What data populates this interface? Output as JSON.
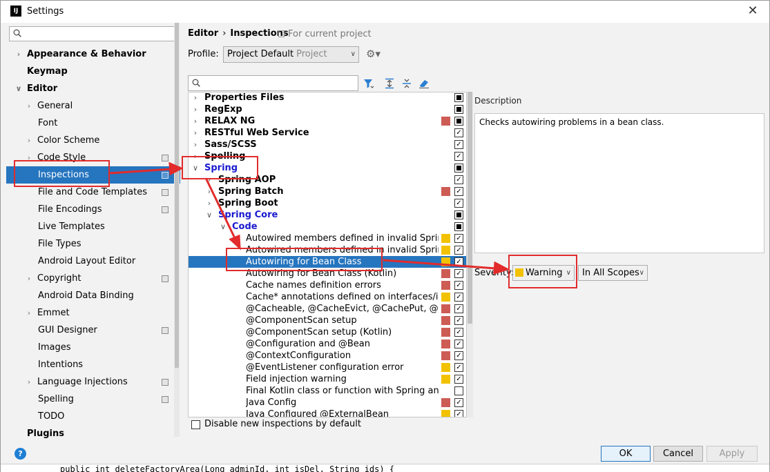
{
  "window": {
    "title": "Settings"
  },
  "sidebar": {
    "search_placeholder": "",
    "items": [
      {
        "label": "Appearance & Behavior",
        "level": 0,
        "expandable": true,
        "expanded": false,
        "bold": true,
        "copy_icon": false
      },
      {
        "label": "Keymap",
        "level": 0,
        "expandable": false,
        "bold": true,
        "copy_icon": false
      },
      {
        "label": "Editor",
        "level": 0,
        "expandable": true,
        "expanded": true,
        "bold": true,
        "copy_icon": false
      },
      {
        "label": "General",
        "level": 1,
        "expandable": true,
        "expanded": false,
        "bold": false,
        "copy_icon": false
      },
      {
        "label": "Font",
        "level": 1,
        "expandable": false,
        "bold": false,
        "copy_icon": false
      },
      {
        "label": "Color Scheme",
        "level": 1,
        "expandable": true,
        "expanded": false,
        "bold": false,
        "copy_icon": false
      },
      {
        "label": "Code Style",
        "level": 1,
        "expandable": true,
        "expanded": false,
        "bold": false,
        "copy_icon": true
      },
      {
        "label": "Inspections",
        "level": 1,
        "expandable": false,
        "bold": false,
        "copy_icon": true,
        "selected": true
      },
      {
        "label": "File and Code Templates",
        "level": 1,
        "expandable": false,
        "bold": false,
        "copy_icon": true
      },
      {
        "label": "File Encodings",
        "level": 1,
        "expandable": false,
        "bold": false,
        "copy_icon": true
      },
      {
        "label": "Live Templates",
        "level": 1,
        "expandable": false,
        "bold": false,
        "copy_icon": false
      },
      {
        "label": "File Types",
        "level": 1,
        "expandable": false,
        "bold": false,
        "copy_icon": false
      },
      {
        "label": "Android Layout Editor",
        "level": 1,
        "expandable": false,
        "bold": false,
        "copy_icon": false
      },
      {
        "label": "Copyright",
        "level": 1,
        "expandable": true,
        "expanded": false,
        "bold": false,
        "copy_icon": true
      },
      {
        "label": "Android Data Binding",
        "level": 1,
        "expandable": false,
        "bold": false,
        "copy_icon": false
      },
      {
        "label": "Emmet",
        "level": 1,
        "expandable": true,
        "expanded": false,
        "bold": false,
        "copy_icon": false
      },
      {
        "label": "GUI Designer",
        "level": 1,
        "expandable": false,
        "bold": false,
        "copy_icon": true
      },
      {
        "label": "Images",
        "level": 1,
        "expandable": false,
        "bold": false,
        "copy_icon": false
      },
      {
        "label": "Intentions",
        "level": 1,
        "expandable": false,
        "bold": false,
        "copy_icon": false
      },
      {
        "label": "Language Injections",
        "level": 1,
        "expandable": true,
        "expanded": false,
        "bold": false,
        "copy_icon": true
      },
      {
        "label": "Spelling",
        "level": 1,
        "expandable": false,
        "bold": false,
        "copy_icon": true
      },
      {
        "label": "TODO",
        "level": 1,
        "expandable": false,
        "bold": false,
        "copy_icon": false
      },
      {
        "label": "Plugins",
        "level": 0,
        "expandable": false,
        "bold": true,
        "copy_icon": false
      }
    ]
  },
  "header": {
    "breadcrumb": [
      "Editor",
      "Inspections"
    ],
    "breadcrumb_sep": "›",
    "note": "For current project"
  },
  "profile": {
    "label": "Profile:",
    "value": "Project Default",
    "sub": "Project"
  },
  "inspections": {
    "search_placeholder": "",
    "rows": [
      {
        "label": "Properties Files",
        "level": 0,
        "chev": "right",
        "style": "bold",
        "sev": "",
        "check": "partial"
      },
      {
        "label": "RegExp",
        "level": 0,
        "chev": "right",
        "style": "bold",
        "sev": "",
        "check": "partial"
      },
      {
        "label": "RELAX NG",
        "level": 0,
        "chev": "right",
        "style": "bold",
        "sev": "red",
        "check": "partial"
      },
      {
        "label": "RESTful Web Service",
        "level": 0,
        "chev": "right",
        "style": "bold",
        "sev": "",
        "check": "checked"
      },
      {
        "label": "Sass/SCSS",
        "level": 0,
        "chev": "right",
        "style": "bold",
        "sev": "",
        "check": "checked"
      },
      {
        "label": "Spelling",
        "level": 0,
        "chev": "right",
        "style": "bold",
        "sev": "",
        "check": "checked"
      },
      {
        "label": "Spring",
        "level": 0,
        "chev": "down",
        "style": "blue",
        "sev": "",
        "check": "partial"
      },
      {
        "label": "Spring AOP",
        "level": 1,
        "chev": "right",
        "style": "bold",
        "sev": "",
        "check": "checked"
      },
      {
        "label": "Spring Batch",
        "level": 1,
        "chev": "right",
        "style": "bold",
        "sev": "red",
        "check": "checked"
      },
      {
        "label": "Spring Boot",
        "level": 1,
        "chev": "right",
        "style": "bold",
        "sev": "",
        "check": "checked"
      },
      {
        "label": "Spring Core",
        "level": 1,
        "chev": "down",
        "style": "blue",
        "sev": "",
        "check": "partial"
      },
      {
        "label": "Code",
        "level": 2,
        "chev": "down",
        "style": "blue",
        "sev": "",
        "check": "partial"
      },
      {
        "label": "Autowired members defined in invalid Spring bean",
        "level": 3,
        "chev": "",
        "style": "",
        "sev": "yellow",
        "check": "checked"
      },
      {
        "label": "Autowired members defined in invalid Spring bean",
        "level": 3,
        "chev": "",
        "style": "",
        "sev": "yellow",
        "check": "checked"
      },
      {
        "label": "Autowiring for Bean Class",
        "level": 3,
        "chev": "",
        "style": "",
        "sev": "yellow",
        "check": "checked",
        "selected": true
      },
      {
        "label": "Autowiring for Bean Class (Kotlin)",
        "level": 3,
        "chev": "",
        "style": "",
        "sev": "red",
        "check": "checked"
      },
      {
        "label": "Cache names definition errors",
        "level": 3,
        "chev": "",
        "style": "",
        "sev": "red",
        "check": "checked"
      },
      {
        "label": "Cache* annotations defined on interfaces/interface methods",
        "level": 3,
        "chev": "",
        "style": "",
        "sev": "yellow",
        "check": "checked"
      },
      {
        "label": "@Cacheable, @CacheEvict, @CachePut, @CacheConfig",
        "level": 3,
        "chev": "",
        "style": "",
        "sev": "red",
        "check": "checked"
      },
      {
        "label": "@ComponentScan setup",
        "level": 3,
        "chev": "",
        "style": "",
        "sev": "red",
        "check": "checked"
      },
      {
        "label": "@ComponentScan setup (Kotlin)",
        "level": 3,
        "chev": "",
        "style": "",
        "sev": "red",
        "check": "checked"
      },
      {
        "label": "@Configuration and @Bean",
        "level": 3,
        "chev": "",
        "style": "",
        "sev": "red",
        "check": "checked"
      },
      {
        "label": "@ContextConfiguration",
        "level": 3,
        "chev": "",
        "style": "",
        "sev": "red",
        "check": "checked"
      },
      {
        "label": "@EventListener configuration error",
        "level": 3,
        "chev": "",
        "style": "",
        "sev": "yellow",
        "check": "checked"
      },
      {
        "label": "Field injection warning",
        "level": 3,
        "chev": "",
        "style": "",
        "sev": "yellow",
        "check": "checked"
      },
      {
        "label": "Final Kotlin class or function with Spring annotation",
        "level": 3,
        "chev": "",
        "style": "",
        "sev": "",
        "check": "unchecked"
      },
      {
        "label": "Java Config",
        "level": 3,
        "chev": "",
        "style": "",
        "sev": "red",
        "check": "checked"
      },
      {
        "label": "Java Configured @ExternalBean",
        "level": 3,
        "chev": "",
        "style": "",
        "sev": "yellow",
        "check": "checked"
      }
    ]
  },
  "description": {
    "label": "Description",
    "text": "Checks autowiring problems in a bean class."
  },
  "severity": {
    "label": "Severity:",
    "value": "Warning",
    "scope": "In All Scopes"
  },
  "disable_new": {
    "label": "Disable new inspections by default",
    "checked": false
  },
  "buttons": {
    "ok": "OK",
    "cancel": "Cancel",
    "apply": "Apply"
  },
  "background_code": "public int deleteFactoryArea(Long adminId, int isDel, String ids) {",
  "colors": {
    "selection": "#2675bf",
    "warning": "#f2c200",
    "error": "#cd5c55",
    "annotation": "#e22b2b",
    "group_blue": "#1a1acf"
  }
}
